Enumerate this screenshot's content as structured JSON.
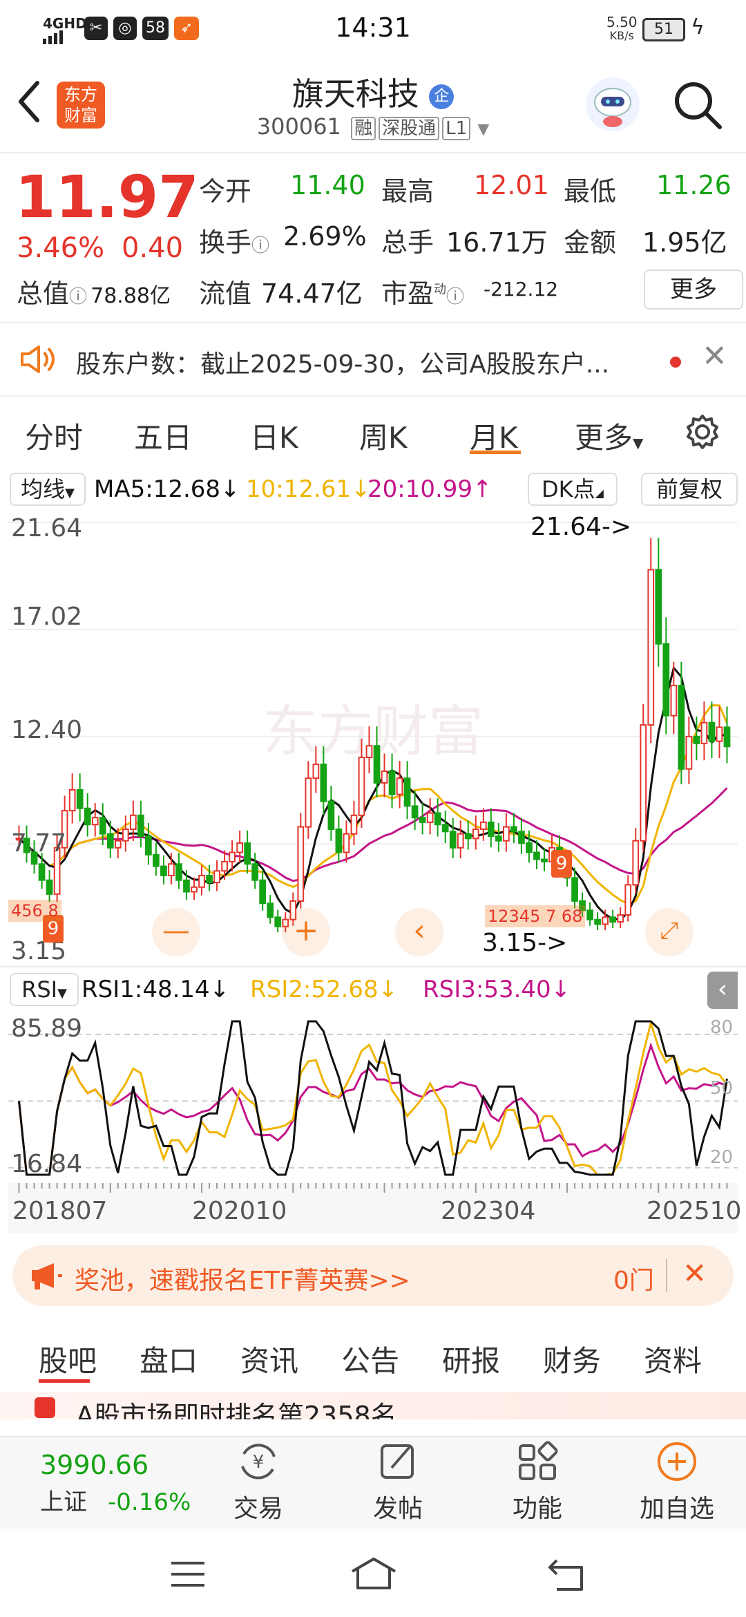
{
  "status_bar": {
    "time": "14:31",
    "network": "4GHD",
    "icons": [
      "scissors-app-icon",
      "pill-app-icon",
      "58-app-icon",
      "feather-app-icon"
    ],
    "app58": "58",
    "speed": "5.50",
    "speed_unit": "KB/s",
    "battery": "51"
  },
  "header": {
    "logo_line1": "东方",
    "logo_line2": "财富",
    "stock_name": "旗天科技",
    "badge": "企",
    "stock_code": "300061",
    "tag1": "融",
    "tag2": "深股通",
    "tag3": "L1"
  },
  "quote": {
    "price": "11.97",
    "change_pct": "3.46%",
    "change": "0.40",
    "open_label": "今开",
    "open": "11.40",
    "high_label": "最高",
    "high": "12.01",
    "low_label": "最低",
    "low": "11.26",
    "turnover_label": "换手",
    "turnover": "2.69%",
    "volume_label": "总手",
    "volume": "16.71万",
    "amount_label": "金额",
    "amount": "1.95亿",
    "total_cap_label": "总值",
    "total_cap": "78.88亿",
    "float_cap_label": "流值",
    "float_cap": "74.47亿",
    "pe_label": "市盈",
    "pe_sup": "动",
    "pe": "-212.12",
    "more_button": "更多"
  },
  "notice": {
    "text": "股东户数：截止2025-09-30，公司A股股东户..."
  },
  "chart_tabs": {
    "items": [
      "分时",
      "五日",
      "日K",
      "周K",
      "月K",
      "更多"
    ],
    "active": "月K"
  },
  "ma_bar": {
    "selector": "均线",
    "ma5": "MA5:12.68",
    "ma10": "10:12.61",
    "ma20": "20:10.99",
    "dk_button": "DK点",
    "adjust_button": "前复权"
  },
  "kline": {
    "y_labels": [
      "21.64",
      "17.02",
      "12.40",
      "7.77",
      "3.15"
    ],
    "max_marker": "21.64->",
    "min_marker": "3.15->",
    "watermark": "东方财富",
    "tag_a": "9",
    "tag_b": "9",
    "num_tag_a": "456 8",
    "num_tag_b": "12345 7 68"
  },
  "rsi": {
    "selector": "RSI",
    "rsi1": "RSI1:48.14",
    "rsi2": "RSI2:52.68",
    "rsi3": "RSI3:53.40",
    "y_top": "85.89",
    "y_bottom": "16.84",
    "right_top": "80",
    "right_mid": "50",
    "right_bottom": "20"
  },
  "x_axis": [
    "201807",
    "202010",
    "202304",
    "202510"
  ],
  "banner": {
    "text": "奖池，速戳报名ETF菁英赛>>",
    "right": "0门"
  },
  "section_tabs": {
    "items": [
      "股吧",
      "盘口",
      "资讯",
      "公告",
      "研报",
      "财务",
      "资料"
    ],
    "active": "股吧"
  },
  "rank_strip": "A股市场即时排名第2358名",
  "bottom_nav": {
    "index_value": "3990.66",
    "index_name": "上证",
    "index_change": "-0.16%",
    "trade": "交易",
    "post": "发帖",
    "functions": "功能",
    "add_watch": "加自选"
  },
  "colors": {
    "red": "#e5342b",
    "green": "#14a314",
    "orange": "#f07a1e",
    "ma5_line": "#111111",
    "ma10_line": "#f0b400",
    "ma20_line": "#c4148a"
  },
  "chart_data": {
    "type": "candlestick",
    "period": "monthly",
    "x_labels": [
      "201807",
      "202010",
      "202304",
      "202510"
    ],
    "ylim": [
      3.15,
      21.64
    ],
    "series": [
      {
        "name": "MA5",
        "last": 12.68
      },
      {
        "name": "MA10",
        "last": 12.61
      },
      {
        "name": "MA20",
        "last": 10.99
      }
    ],
    "close": [
      8.0,
      7.4,
      6.9,
      6.2,
      5.6,
      7.6,
      9.2,
      10.1,
      9.3,
      8.6,
      8.9,
      8.2,
      7.6,
      7.9,
      8.4,
      9.0,
      8.1,
      7.3,
      6.8,
      6.4,
      6.9,
      6.2,
      5.7,
      5.9,
      6.4,
      6.1,
      6.6,
      7.0,
      7.4,
      7.8,
      6.9,
      6.2,
      5.2,
      4.6,
      4.2,
      4.5,
      5.3,
      8.5,
      10.6,
      11.2,
      9.6,
      8.4,
      7.4,
      8.2,
      9.0,
      11.5,
      12.0,
      10.4,
      10.9,
      9.9,
      10.6,
      9.4,
      8.9,
      8.7,
      9.1,
      8.6,
      8.3,
      7.6,
      8.2,
      8.0,
      8.4,
      8.7,
      8.1,
      7.9,
      8.5,
      8.3,
      7.8,
      7.4,
      7.1,
      7.0,
      7.6,
      6.8,
      6.3,
      5.3,
      4.9,
      4.5,
      4.3,
      4.6,
      4.4,
      4.7,
      6.0,
      7.9,
      12.9,
      19.6,
      16.4,
      13.3,
      14.6,
      11.0,
      12.4,
      12.1,
      13.0,
      12.2,
      12.8,
      11.97
    ],
    "rsi1_last": 48.14,
    "rsi2_last": 52.68,
    "rsi3_last": 53.4,
    "rsi_ylim": [
      16.84,
      85.89
    ],
    "rsi_levels": [
      20,
      50,
      80
    ]
  }
}
